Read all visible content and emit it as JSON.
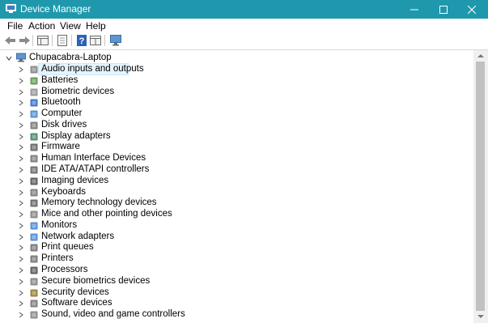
{
  "window": {
    "title": "Device Manager",
    "accent": "#1f98ad"
  },
  "menu": [
    "File",
    "Action",
    "View",
    "Help"
  ],
  "toolbar_icons": [
    "back-arrow-icon",
    "forward-arrow-icon",
    "properties-pane-icon",
    "list-view-icon",
    "help-icon",
    "resources-view-icon",
    "monitor-scan-icon"
  ],
  "tree": {
    "root": "Chupacabra-Laptop",
    "selected_index": 0,
    "categories": [
      {
        "label": "Audio inputs and outputs",
        "icon": "speaker-icon"
      },
      {
        "label": "Batteries",
        "icon": "battery-icon"
      },
      {
        "label": "Biometric devices",
        "icon": "biometric-icon"
      },
      {
        "label": "Bluetooth",
        "icon": "bluetooth-icon"
      },
      {
        "label": "Computer",
        "icon": "computer-icon"
      },
      {
        "label": "Disk drives",
        "icon": "disk-drive-icon"
      },
      {
        "label": "Display adapters",
        "icon": "display-adapter-icon"
      },
      {
        "label": "Firmware",
        "icon": "firmware-icon"
      },
      {
        "label": "Human Interface Devices",
        "icon": "hid-icon"
      },
      {
        "label": "IDE ATA/ATAPI controllers",
        "icon": "ide-controller-icon"
      },
      {
        "label": "Imaging devices",
        "icon": "camera-icon"
      },
      {
        "label": "Keyboards",
        "icon": "keyboard-icon"
      },
      {
        "label": "Memory technology devices",
        "icon": "memory-icon"
      },
      {
        "label": "Mice and other pointing devices",
        "icon": "mouse-icon"
      },
      {
        "label": "Monitors",
        "icon": "monitor-icon"
      },
      {
        "label": "Network adapters",
        "icon": "network-adapter-icon"
      },
      {
        "label": "Print queues",
        "icon": "print-queue-icon"
      },
      {
        "label": "Printers",
        "icon": "printer-icon"
      },
      {
        "label": "Processors",
        "icon": "processor-icon"
      },
      {
        "label": "Secure biometrics devices",
        "icon": "secure-biometric-icon"
      },
      {
        "label": "Security devices",
        "icon": "security-device-icon"
      },
      {
        "label": "Software devices",
        "icon": "software-device-icon"
      },
      {
        "label": "Sound, video and game controllers",
        "icon": "sound-controller-icon"
      }
    ]
  }
}
